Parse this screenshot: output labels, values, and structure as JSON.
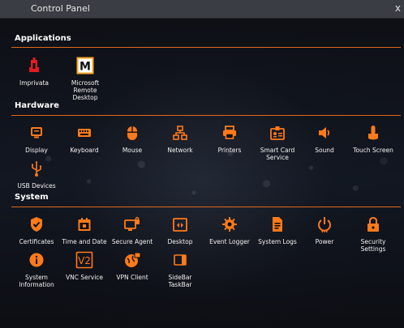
{
  "window": {
    "title": "Control Panel",
    "close_label": "x"
  },
  "sections": {
    "applications": {
      "title": "Applications",
      "items": [
        {
          "label": "Imprivata",
          "icon": "imprivata-icon"
        },
        {
          "label": "Microsoft\nRemote\nDesktop",
          "icon": "microsoft-remote-desktop-icon"
        }
      ]
    },
    "hardware": {
      "title": "Hardware",
      "items": [
        {
          "label": "Display",
          "icon": "display-icon"
        },
        {
          "label": "Keyboard",
          "icon": "keyboard-icon"
        },
        {
          "label": "Mouse",
          "icon": "mouse-icon"
        },
        {
          "label": "Network",
          "icon": "network-icon"
        },
        {
          "label": "Printers",
          "icon": "printer-icon"
        },
        {
          "label": "Smart Card Service",
          "icon": "smart-card-icon"
        },
        {
          "label": "Sound",
          "icon": "speaker-icon"
        },
        {
          "label": "Touch Screen",
          "icon": "touch-screen-icon"
        },
        {
          "label": "USB Devices",
          "icon": "usb-icon"
        }
      ]
    },
    "system": {
      "title": "System",
      "items": [
        {
          "label": "Certificates",
          "icon": "certificate-shield-icon"
        },
        {
          "label": "Time and Date",
          "icon": "calendar-icon"
        },
        {
          "label": "Secure Agent",
          "icon": "secure-agent-icon"
        },
        {
          "label": "Desktop",
          "icon": "desktop-icon"
        },
        {
          "label": "Event Logger",
          "icon": "event-logger-gear-icon"
        },
        {
          "label": "System Logs",
          "icon": "document-icon"
        },
        {
          "label": "Power",
          "icon": "power-icon"
        },
        {
          "label": "Security Settings",
          "icon": "lock-icon"
        },
        {
          "label": "System Information",
          "icon": "info-icon"
        },
        {
          "label": "VNC Service",
          "icon": "vnc-icon"
        },
        {
          "label": "VPN Client",
          "icon": "vpn-globe-icon"
        },
        {
          "label": "SideBar TaskBar",
          "icon": "sidebar-taskbar-icon"
        }
      ]
    }
  },
  "colors": {
    "accent": "#ff7a1a",
    "imprivata": "#e31b23",
    "titlebar": "#3a3d43"
  }
}
